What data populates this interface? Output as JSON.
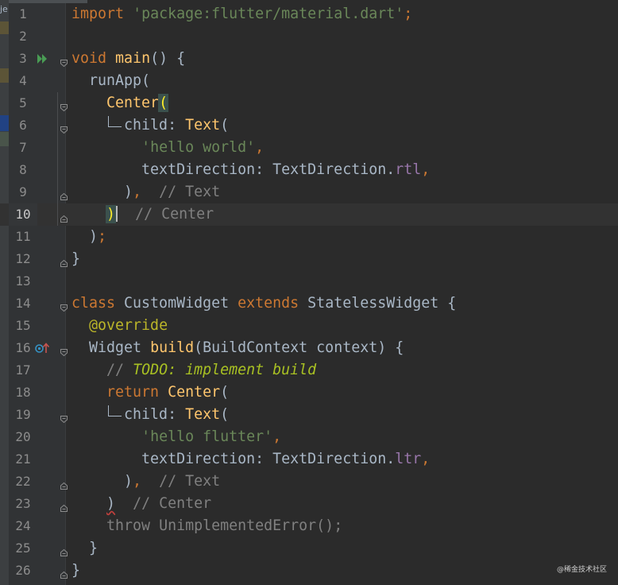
{
  "left_strip": {
    "label": "je"
  },
  "lines": [
    {
      "n": "1",
      "code": "<span class=\"kw\">import</span> <span class=\"str\">'package:flutter/material.dart'</span><span class=\"kw\">;</span>"
    },
    {
      "n": "2",
      "code": ""
    },
    {
      "n": "3",
      "code": "<span class=\"kw\">void</span> <span class=\"fn\">main</span>() {"
    },
    {
      "n": "4",
      "code": "  runApp("
    },
    {
      "n": "5",
      "code": "    <span class=\"fn\">Center</span><span class=\"brace-match\">(</span>"
    },
    {
      "n": "6",
      "code": "      child: <span class=\"fn\">Text</span>("
    },
    {
      "n": "7",
      "code": "        <span class=\"str\">'hello world'</span><span class=\"kw\">,</span>"
    },
    {
      "n": "8",
      "code": "        textDirection: TextDirection.<span class=\"prop\">rtl</span><span class=\"kw\">,</span>"
    },
    {
      "n": "9",
      "code": "      )<span class=\"kw\">,</span>  <span class=\"cmt\">// Text</span>"
    },
    {
      "n": "10",
      "code": "    <span class=\"brace-match\">)</span><span class=\"cursor\"></span>  <span class=\"cmt\">// Center</span>"
    },
    {
      "n": "11",
      "code": "  )<span class=\"kw\">;</span>"
    },
    {
      "n": "12",
      "code": "}"
    },
    {
      "n": "13",
      "code": ""
    },
    {
      "n": "14",
      "code": "<span class=\"kw\">class</span> CustomWidget <span class=\"kw\">extends</span> StatelessWidget {"
    },
    {
      "n": "15",
      "code": "  <span class=\"ann\">@override</span>"
    },
    {
      "n": "16",
      "code": "  Widget <span class=\"fn\">build</span>(BuildContext context) {"
    },
    {
      "n": "17",
      "code": "    <span class=\"cmt\">// </span><span class=\"todo\">TODO: implement build</span>"
    },
    {
      "n": "18",
      "code": "    <span class=\"kw\">return</span> <span class=\"fn\">Center</span>("
    },
    {
      "n": "19",
      "code": "      child: <span class=\"fn\">Text</span>("
    },
    {
      "n": "20",
      "code": "        <span class=\"str\">'hello flutter'</span><span class=\"kw\">,</span>"
    },
    {
      "n": "21",
      "code": "        textDirection: TextDirection.<span class=\"prop\">ltr</span><span class=\"kw\">,</span>"
    },
    {
      "n": "22",
      "code": "      )<span class=\"kw\">,</span>  <span class=\"cmt\">// Text</span>"
    },
    {
      "n": "23",
      "code": "    <span class=\"squiggle\">)</span>  <span class=\"cmt\">// Center</span>"
    },
    {
      "n": "24",
      "code": "    <span class=\"unused\">throw UnimplementedError();</span>"
    },
    {
      "n": "25",
      "code": "  }"
    },
    {
      "n": "26",
      "code": "}"
    }
  ],
  "gutter_icons": [
    {
      "line": "3",
      "icon": "run-icon"
    },
    {
      "line": "16",
      "icon": "override-icon"
    }
  ],
  "watermark": "@稀金技术社区",
  "colors": {
    "background": "#2b2b2b",
    "gutter": "#313335",
    "keyword": "#cc7832",
    "string": "#6a8759",
    "function": "#ffc66d",
    "annotation": "#bbb529",
    "comment": "#808080",
    "todo": "#a8c023",
    "property": "#9876aa",
    "default_text": "#a9b7c6"
  }
}
